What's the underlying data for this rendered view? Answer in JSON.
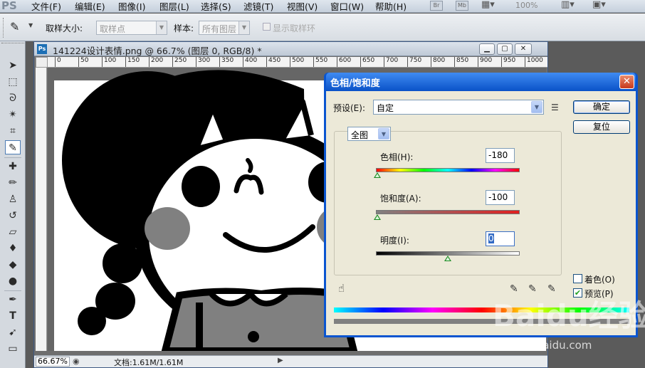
{
  "menubar": {
    "logo": "PS",
    "items": [
      "文件(F)",
      "编辑(E)",
      "图像(I)",
      "图层(L)",
      "选择(S)",
      "滤镜(T)",
      "视图(V)",
      "窗口(W)",
      "帮助(H)"
    ],
    "apps": [
      "Br",
      "Mb"
    ],
    "zoom": "100%"
  },
  "options": {
    "sample_size_label": "取样大小:",
    "sample_size_value": "取样点",
    "sample_label": "样本:",
    "sample_value": "所有图层",
    "show_ring_label": "显示取样环"
  },
  "document": {
    "title": "141224设计表情.png @ 66.7% (图层 0, RGB/8) *",
    "zoom": "66.67%",
    "doc_size": "文档:1.61M/1.61M",
    "ruler_ticks": [
      "0",
      "50",
      "100",
      "150",
      "200",
      "250",
      "300",
      "350",
      "400",
      "450",
      "500",
      "550",
      "600",
      "650",
      "700",
      "750",
      "800",
      "850",
      "900",
      "950",
      "1000"
    ]
  },
  "dialog": {
    "title": "色相/饱和度",
    "preset_label": "预设(E):",
    "preset_value": "自定",
    "ok_label": "确定",
    "reset_label": "复位",
    "channel_value": "全图",
    "hue_label": "色相(H):",
    "hue_value": "-180",
    "saturation_label": "饱和度(A):",
    "saturation_value": "-100",
    "lightness_label": "明度(I):",
    "lightness_value": "0",
    "colorize_label": "着色(O)",
    "colorize_checked": false,
    "preview_label": "预览(P)",
    "preview_checked": true
  },
  "watermark": {
    "brand": "Baidu经验",
    "url": "jingyan.baidu.com"
  },
  "colors": {
    "dialog_title": "#0a55d0",
    "dialog_body": "#ece9d8",
    "thumb": "#1d8a24"
  }
}
